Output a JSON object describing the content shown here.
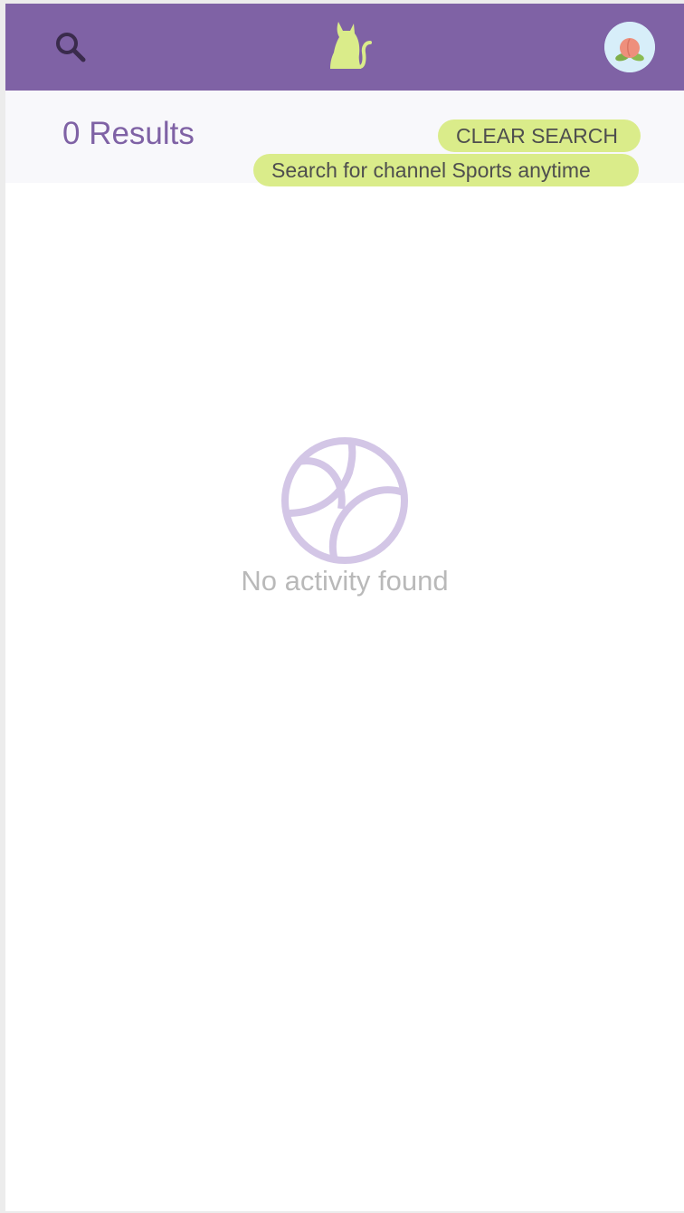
{
  "header": {
    "search_icon": "search-icon",
    "logo_icon": "cat-logo-icon",
    "avatar_icon": "peach-avatar-icon",
    "brand_color": "#7f62a5",
    "accent_color": "#daec8a"
  },
  "results": {
    "count_label": "0 Results",
    "clear_label": "CLEAR SEARCH",
    "query_label": "Search for channel Sports anytime"
  },
  "empty_state": {
    "icon": "basketball-icon",
    "message": "No activity found"
  }
}
